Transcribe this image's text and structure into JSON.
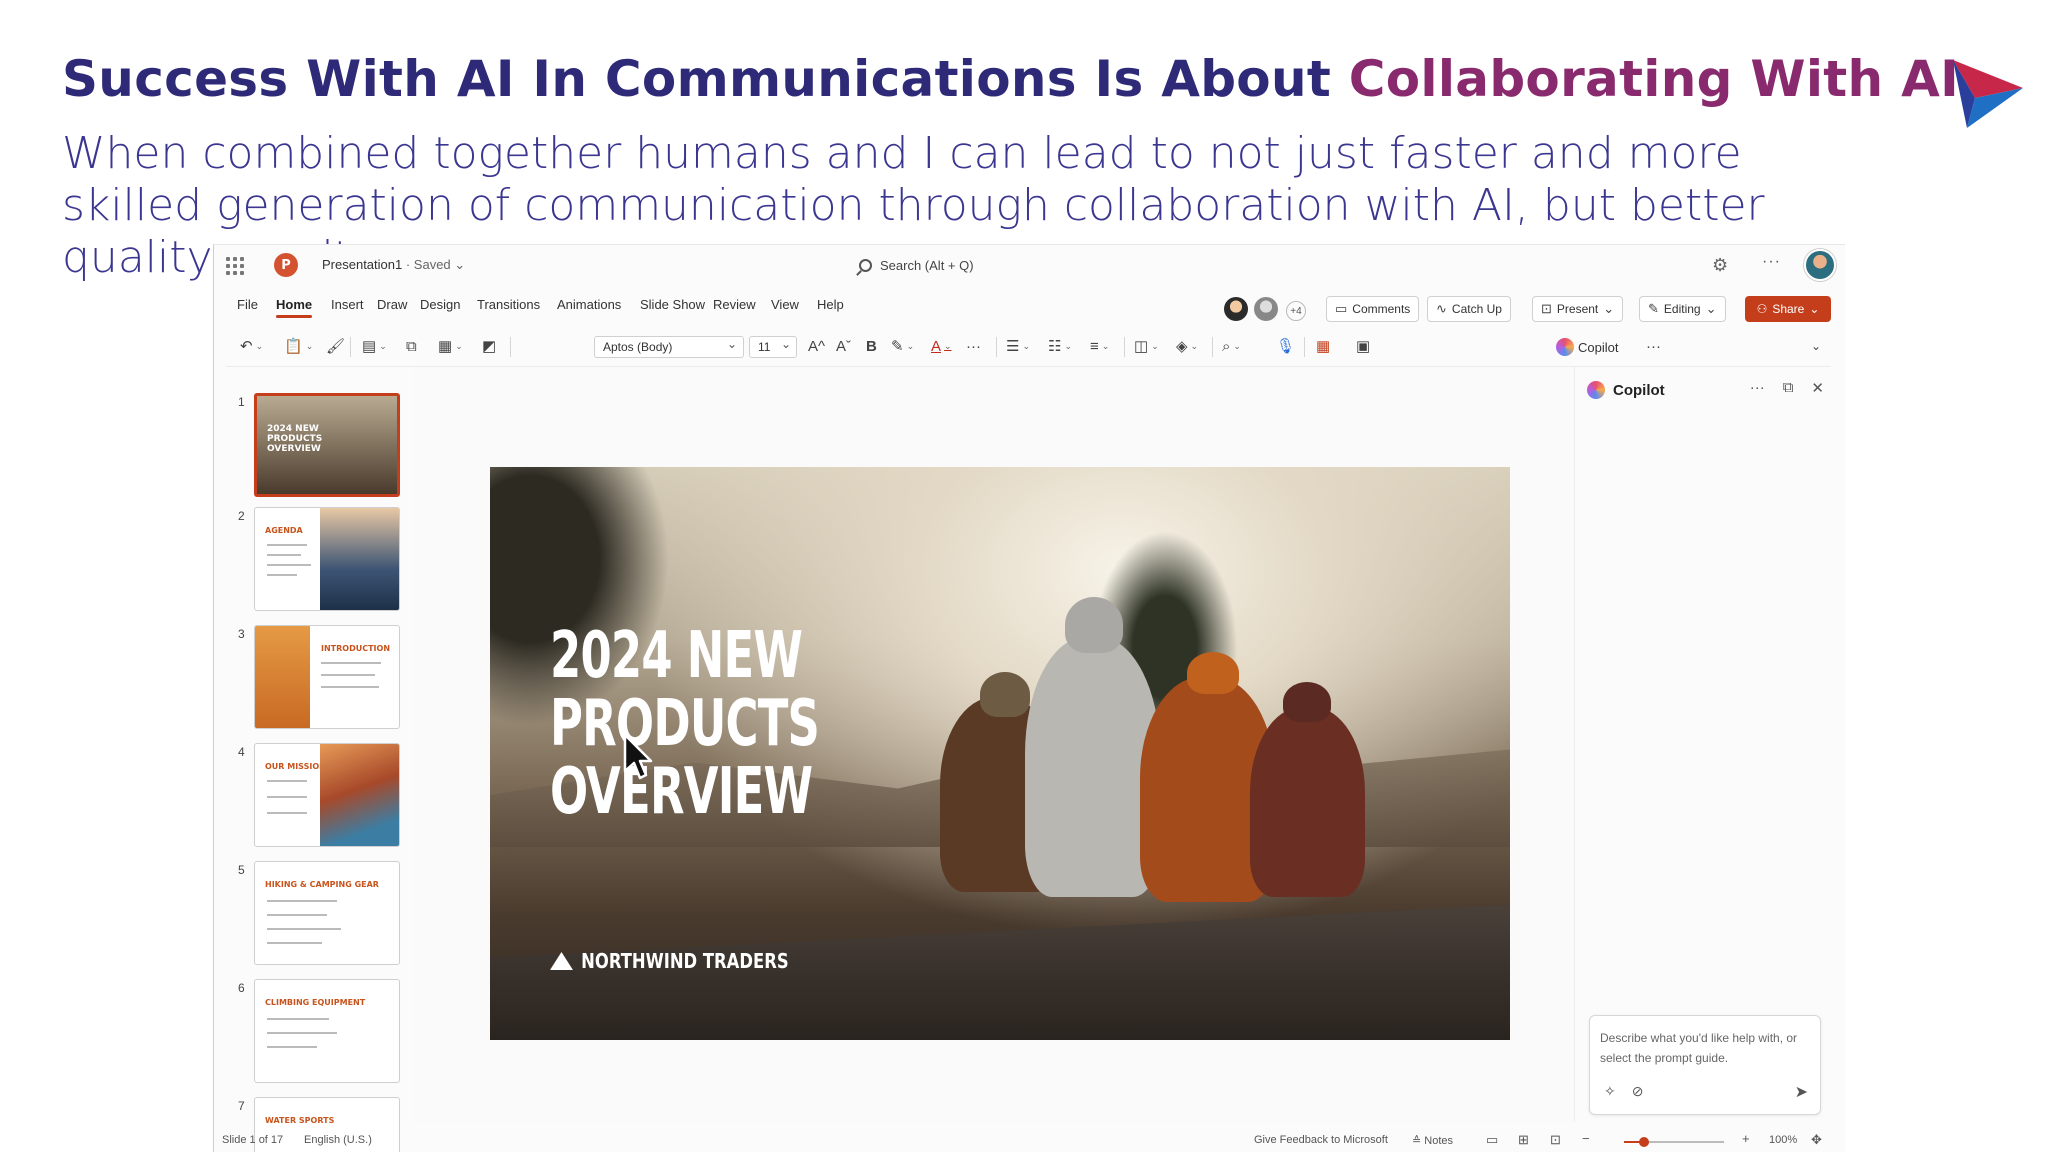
{
  "headline": {
    "part1": "Success With AI In Communications Is About ",
    "part2": "Collaborating With AI"
  },
  "subheadline": "When combined together humans and I can lead to not just faster and more skilled generation of communication through collaboration with AI, but better quality results.",
  "app": {
    "logo_letter": "P",
    "doc_name": "Presentation1",
    "doc_status": " · Saved ⌄",
    "search_label": "Search (Alt + Q)",
    "settings_icon": "gear-icon",
    "more_icon": "more-icon",
    "menu": [
      "File",
      "Home",
      "Insert",
      "Draw",
      "Design",
      "Transitions",
      "Animations",
      "Slide Show",
      "Review",
      "View",
      "Help"
    ],
    "active_menu": "Home",
    "collaborator_count": "+4",
    "buttons": {
      "comments": "Comments",
      "catch_up": "Catch Up",
      "present": "Present",
      "editing": "Editing",
      "share": "Share"
    },
    "ribbon": {
      "font_name": "Aptos (Body)",
      "font_size": "11",
      "grow_font": "A^",
      "shrink_font": "Aˇ",
      "bold": "B",
      "copilot": "Copilot"
    }
  },
  "thumbnails": {
    "numbers": [
      "1",
      "2",
      "3",
      "4",
      "5",
      "6",
      "7"
    ],
    "titles": [
      "2024 NEW PRODUCTS OVERVIEW",
      "AGENDA",
      "INTRODUCTION",
      "OUR MISSION",
      "HIKING & CAMPING GEAR",
      "CLIMBING EQUIPMENT",
      "WATER SPORTS"
    ]
  },
  "slide": {
    "title_lines": [
      "2024 NEW",
      "PRODUCTS",
      "OVERVIEW"
    ],
    "brand": "NORTHWIND TRADERS"
  },
  "copilot": {
    "title": "Copilot",
    "placeholder": "Describe what you'd like help with, or select the prompt guide."
  },
  "status": {
    "slide_counter": "Slide 1 of 17",
    "language": "English (U.S.)",
    "feedback": "Give Feedback to Microsoft",
    "notes": "Notes",
    "zoom": "100%",
    "zoom_level_fraction": 0.2
  },
  "colors": {
    "headline_blue": "#2e2a78",
    "headline_magenta": "#8a2a6e",
    "accent_orange": "#c43e1c"
  }
}
